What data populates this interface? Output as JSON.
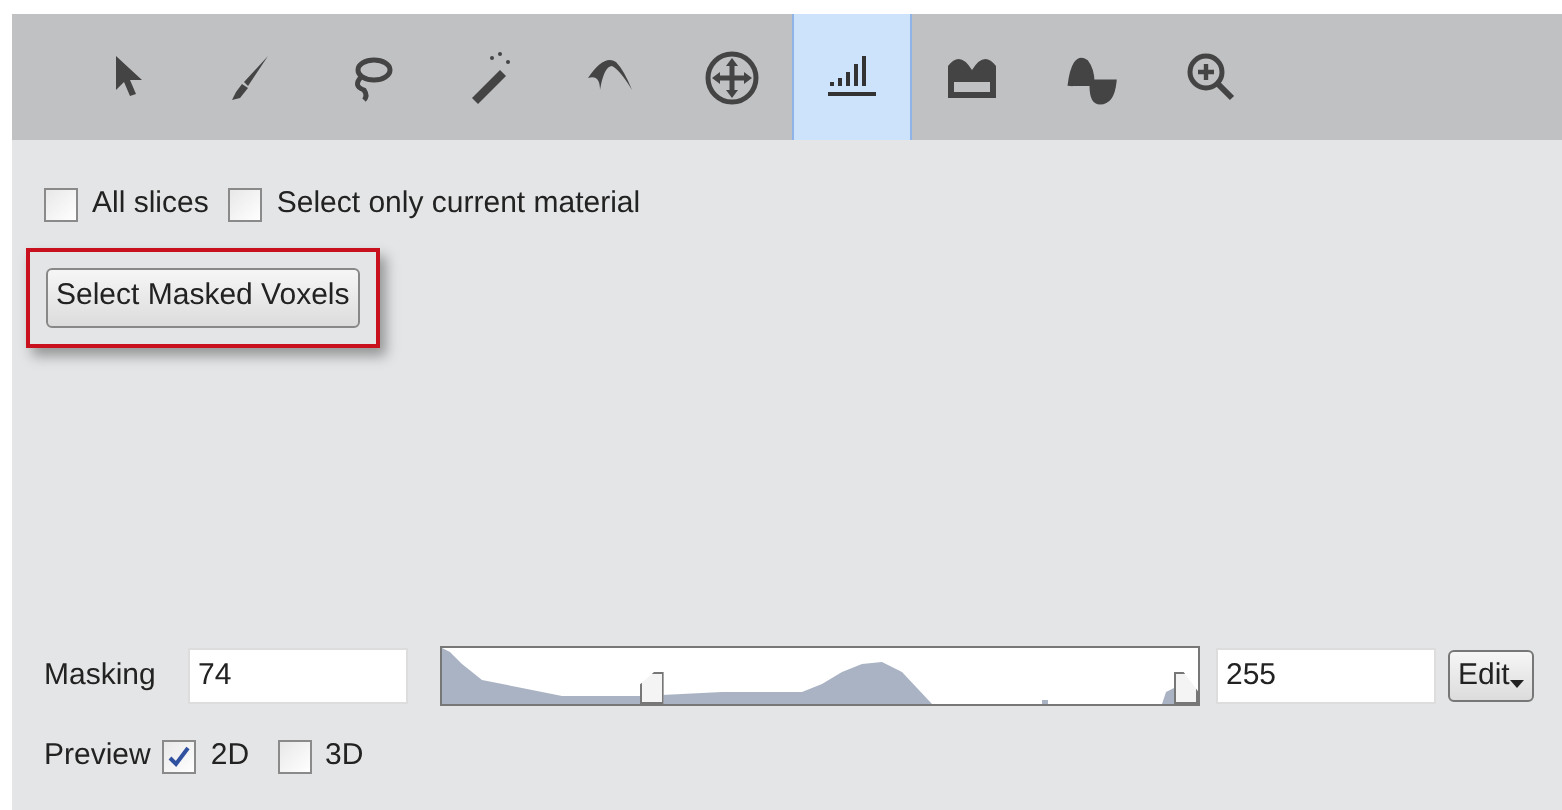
{
  "toolbar": {
    "tools": [
      {
        "kind": "pointer",
        "selected": false
      },
      {
        "kind": "brush",
        "selected": false
      },
      {
        "kind": "lasso",
        "selected": false
      },
      {
        "kind": "wand",
        "selected": false
      },
      {
        "kind": "propagate",
        "selected": false
      },
      {
        "kind": "move",
        "selected": false
      },
      {
        "kind": "threshold",
        "selected": true
      },
      {
        "kind": "blow",
        "selected": false
      },
      {
        "kind": "snake",
        "selected": false
      },
      {
        "kind": "zoom",
        "selected": false
      }
    ]
  },
  "options": [
    {
      "label": "All slices",
      "checked": false
    },
    {
      "label": "Select only current material",
      "checked": false
    }
  ],
  "select_button": {
    "label": "Select Masked Voxels",
    "highlighted": true
  },
  "masking": {
    "label": "Masking",
    "low_value": "74",
    "high_value": "255",
    "low_handle": {
      "level": 0.27
    },
    "high_handle": {
      "level": 1.0
    },
    "edit_button": "Edit"
  },
  "preview": {
    "label": "Preview",
    "options": [
      {
        "label": "2D",
        "checked": true
      },
      {
        "label": "3D",
        "checked": false
      }
    ]
  }
}
